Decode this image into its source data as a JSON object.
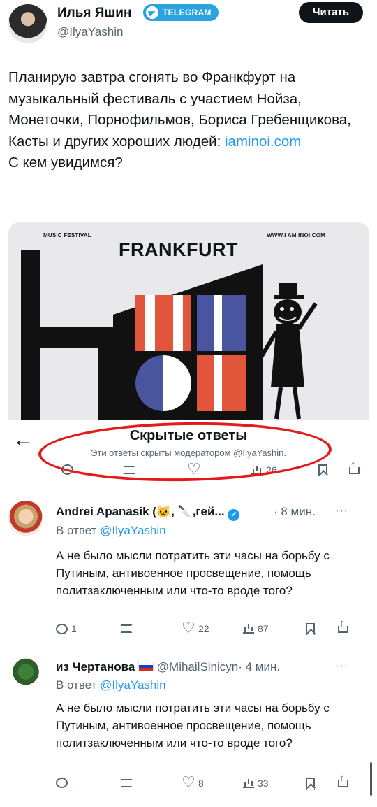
{
  "tweet": {
    "author_name": "Илья Яшин",
    "badge_label": "TELEGRAM",
    "author_handle": "@IlyaYashin",
    "read_button": "Читать",
    "text_before_link": "Планирую завтра сгонять во Франкфурт на музыкальный фестиваль с участием Нойза, Монеточки, Порнофильмов, Бориса Гребенщикова, Касты и других хороших людей: ",
    "link": "iaminoi.com",
    "text_after_link": "С кем увидимся?"
  },
  "poster": {
    "label_left": "MUSIC FESTIVAL",
    "label_right": "WWW.I AM INOI.COM",
    "title": "FRANKFURT"
  },
  "hidden_replies": {
    "title": "Скрытые ответы",
    "subtitle": "Эти ответы скрыты модератором @IlyaYashin.",
    "views": "26"
  },
  "replies": [
    {
      "name": "Andrei Apanasik (🐱, 🔪,гей...",
      "time": "· 8 мин.",
      "reply_to_prefix": "В ответ ",
      "reply_to_handle": "@IlyaYashin",
      "body": "А не было мысли потратить эти часы на борьбу с Путиным, антивоенное просвещение, помощь политзаключенным или что-то вроде того?",
      "replies": "1",
      "likes": "22",
      "views": "87"
    },
    {
      "name": "из Чертанова",
      "handle": "@MihailSinicyn",
      "time": "· 4 мин.",
      "reply_to_prefix": "В ответ ",
      "reply_to_handle": "@IlyaYashin",
      "body": "А не было мысли потратить эти часы на борьбу с Путиным, антивоенное просвещение, помощь политзаключенным или что-то вроде того?",
      "likes": "8",
      "views": "33"
    }
  ],
  "icons": {
    "back": "←",
    "more": "···",
    "verified": "✓"
  },
  "colors": {
    "accent": "#1d9bf0",
    "telegram": "#2aa3e0",
    "annotation": "#e21b1b",
    "poster_red": "#e1553a",
    "poster_blue": "#4a55a0"
  }
}
